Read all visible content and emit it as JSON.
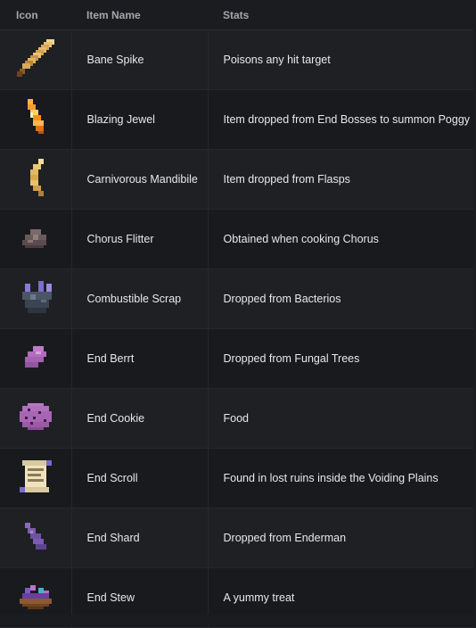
{
  "table": {
    "headers": {
      "icon": "Icon",
      "name": "Item Name",
      "stats": "Stats"
    },
    "rows": [
      {
        "icon": "bane-spike-icon",
        "name": "Bane Spike",
        "stats": "Poisons any hit target"
      },
      {
        "icon": "blazing-jewel-icon",
        "name": "Blazing Jewel",
        "stats": "Item dropped from End Bosses to summon Poggy"
      },
      {
        "icon": "carnivorous-mandibile-icon",
        "name": "Carnivorous Mandibile",
        "stats": "Item dropped from Flasps"
      },
      {
        "icon": "chorus-flitter-icon",
        "name": "Chorus Flitter",
        "stats": "Obtained when cooking Chorus"
      },
      {
        "icon": "combustible-scrap-icon",
        "name": "Combustible Scrap",
        "stats": "Dropped from Bacterios"
      },
      {
        "icon": "end-berrt-icon",
        "name": "End Berrt",
        "stats": "Dropped from Fungal Trees"
      },
      {
        "icon": "end-cookie-icon",
        "name": "End Cookie",
        "stats": "Food"
      },
      {
        "icon": "end-scroll-icon",
        "name": "End Scroll",
        "stats": "Found in lost ruins inside the Voiding Plains"
      },
      {
        "icon": "end-shard-icon",
        "name": "End Shard",
        "stats": "Dropped from Enderman"
      },
      {
        "icon": "end-stew-icon",
        "name": "End Stew",
        "stats": "A yummy treat"
      }
    ]
  },
  "colors": {
    "background": "#1b1c20",
    "row_odd": "#1f2024",
    "row_even": "#191a1e",
    "header_text": "#a3a6ad",
    "cell_text": "#e8e8ea"
  }
}
